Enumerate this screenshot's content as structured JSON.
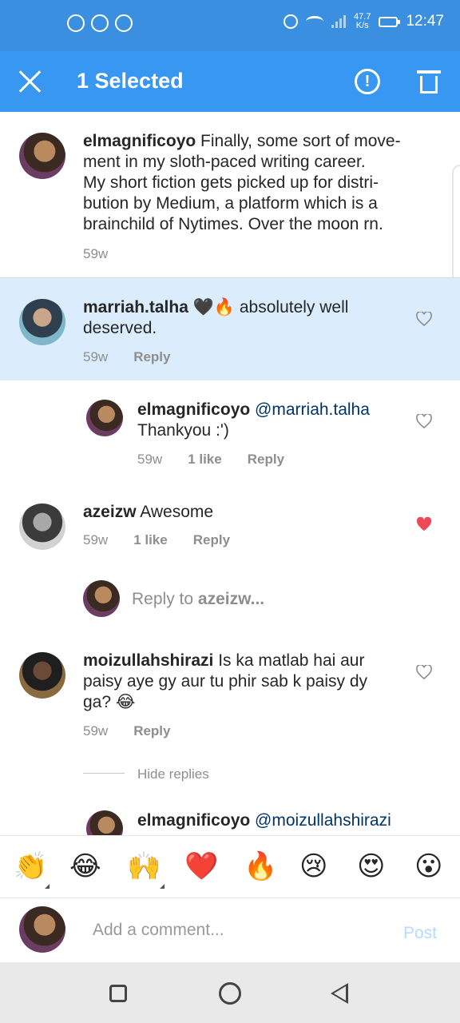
{
  "status_bar": {
    "net_speed_value": "47.7",
    "net_speed_unit": "K/s",
    "time": "12:47"
  },
  "header": {
    "title": "1 Selected",
    "icons": [
      "close-icon",
      "report-icon",
      "delete-icon"
    ]
  },
  "comments": [
    {
      "user": "elmagnificoyo",
      "lines": [
        "Finally, some sort of move-",
        "ment in my sloth-paced writing career.",
        "My short fiction gets picked up for distri-",
        "bution by Medium, a platform which is a",
        "brainchild of Nytimes. Over the moon rn."
      ],
      "time": "59w"
    },
    {
      "user": "marriah.talha",
      "text_before": "🖤🔥 absolutely well",
      "text_line2": "deserved.",
      "time": "59w",
      "reply_label": "Reply",
      "liked": false
    },
    {
      "user": "elmagnificoyo",
      "mention": "@marriah.talha",
      "text_line2": "Thankyou :')",
      "time": "59w",
      "likes": "1 like",
      "reply_label": "Reply",
      "liked": false
    },
    {
      "user": "azeizw",
      "text": "Awesome",
      "time": "59w",
      "likes": "1 like",
      "reply_label": "Reply",
      "liked": true
    },
    {
      "reply_prompt": "Reply to",
      "reply_target": "azeizw..."
    },
    {
      "user": "moizullahshirazi",
      "line1": "Is ka matlab hai aur",
      "line2": "paisy aye gy aur tu phir sab k paisy dy",
      "line3": "ga? 😂",
      "time": "59w",
      "reply_label": "Reply",
      "liked": false
    },
    {
      "hide_replies": "Hide replies"
    },
    {
      "user": "elmagnificoyo",
      "mention": "@moizullahshirazi"
    }
  ],
  "quick_emojis": [
    "👏",
    "😂",
    "🙌",
    "❤️",
    "🔥",
    "😢",
    "😍",
    "😮"
  ],
  "composer": {
    "placeholder": "Add a comment...",
    "post_label": "Post"
  },
  "colors": {
    "app_bar": "#3897f0",
    "selected_row": "#dbecfd",
    "liked_heart": "#ed4956",
    "mention": "#003569"
  }
}
